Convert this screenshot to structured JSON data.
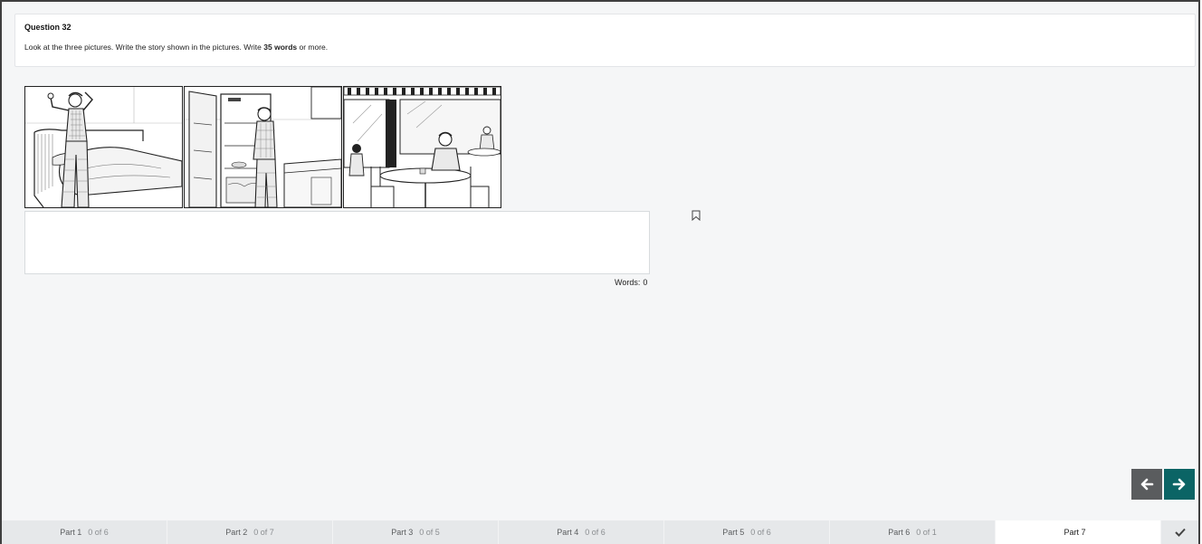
{
  "question": {
    "title": "Question 32",
    "instruction_before": "Look at the three pictures. Write the story shown in the pictures. Write ",
    "instruction_bold": "35 words",
    "instruction_after": " or more."
  },
  "pictures": [
    {
      "icon": "man-waking-up-in-bedroom-picture"
    },
    {
      "icon": "man-looking-in-empty-fridge-picture"
    },
    {
      "icon": "man-eating-in-cafe-picture"
    }
  ],
  "answer": {
    "value": "",
    "placeholder": ""
  },
  "word_count": {
    "label": "Words:",
    "value": "0"
  },
  "parts": [
    {
      "label": "Part 1",
      "progress": "0 of 6"
    },
    {
      "label": "Part 2",
      "progress": "0 of 7"
    },
    {
      "label": "Part 3",
      "progress": "0 of 5"
    },
    {
      "label": "Part 4",
      "progress": "0 of 6"
    },
    {
      "label": "Part 5",
      "progress": "0 of 6"
    },
    {
      "label": "Part 6",
      "progress": "0 of 1"
    },
    {
      "label": "Part 7",
      "progress": ""
    }
  ],
  "colors": {
    "next_button": "#0b6465",
    "prev_button": "#5a5c5e",
    "background": "#f5f6f7"
  },
  "icons": {
    "prev": "arrow-left-icon",
    "next": "arrow-right-icon",
    "bookmark": "bookmark-icon",
    "submit": "check-icon"
  }
}
